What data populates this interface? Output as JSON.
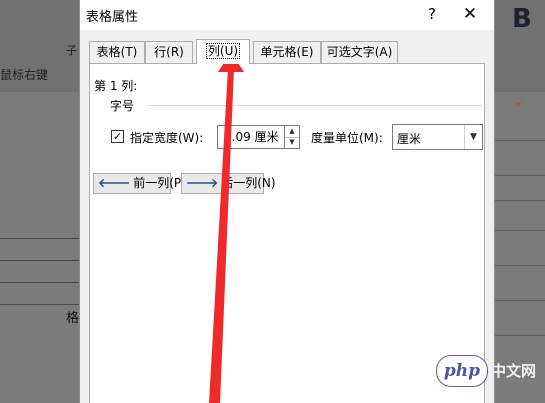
{
  "background": {
    "hint_text": "鼠标右键",
    "edge_char": "子",
    "table_char": "格",
    "letter": "B"
  },
  "dialog": {
    "title": "表格属性",
    "help_label": "?",
    "close_label": "✕",
    "tabs": [
      {
        "label": "表格(T)",
        "active": false
      },
      {
        "label": "行(R)",
        "active": false
      },
      {
        "label": "列(U)",
        "active": true
      },
      {
        "label": "单元格(E)",
        "active": false
      },
      {
        "label": "可选文字(A)",
        "active": false
      }
    ],
    "column_heading": "第 1 列:",
    "group_label": "字号",
    "preferred_width": {
      "checked": true,
      "label": "指定宽度(W):",
      "value": "2.09 厘米"
    },
    "unit": {
      "label": "度量单位(M):",
      "selected": "厘米"
    },
    "buttons": {
      "prev_column": "前一列(P)",
      "next_column": "后一列(N)"
    }
  },
  "watermark": {
    "logo": "php",
    "text": "中文网"
  },
  "colors": {
    "annotation_arrow": "#ee2a2a",
    "dialog_background": "#f0f0f0",
    "watermark_blue": "#4a56a8"
  },
  "icons": {
    "prev": "arrow-left-icon",
    "next": "arrow-right-icon",
    "spinner_up": "triangle-up-icon",
    "spinner_down": "triangle-down-icon",
    "dropdown": "chevron-down-icon"
  }
}
